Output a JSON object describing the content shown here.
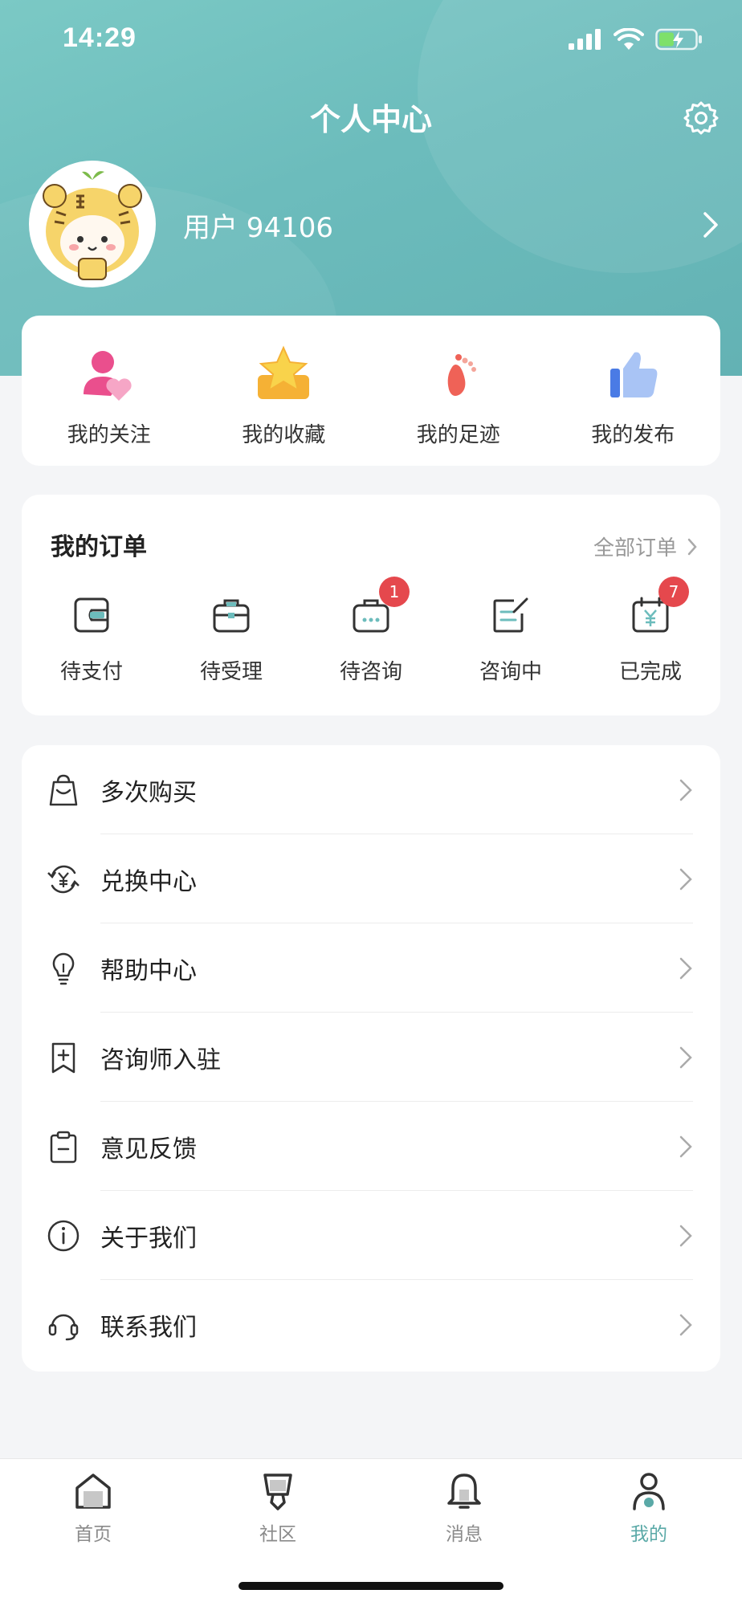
{
  "status": {
    "time": "14:29"
  },
  "header": {
    "title": "个人中心"
  },
  "profile": {
    "username": "用户 94106"
  },
  "quick_links": [
    {
      "label": "我的关注",
      "icon": "follow-icon"
    },
    {
      "label": "我的收藏",
      "icon": "star-icon"
    },
    {
      "label": "我的足迹",
      "icon": "footprint-icon"
    },
    {
      "label": "我的发布",
      "icon": "thumb-icon"
    }
  ],
  "orders": {
    "title": "我的订单",
    "all_label": "全部订单",
    "items": [
      {
        "label": "待支付",
        "badge": ""
      },
      {
        "label": "待受理",
        "badge": ""
      },
      {
        "label": "待咨询",
        "badge": "1"
      },
      {
        "label": "咨询中",
        "badge": ""
      },
      {
        "label": "已完成",
        "badge": "7"
      }
    ]
  },
  "menu": [
    {
      "label": "多次购买",
      "icon": "shopping-bag-icon"
    },
    {
      "label": "兑换中心",
      "icon": "exchange-icon"
    },
    {
      "label": "帮助中心",
      "icon": "lightbulb-icon"
    },
    {
      "label": "咨询师入驻",
      "icon": "bookmark-plus-icon"
    },
    {
      "label": "意见反馈",
      "icon": "clipboard-icon"
    },
    {
      "label": "关于我们",
      "icon": "info-icon"
    },
    {
      "label": "联系我们",
      "icon": "headset-icon"
    }
  ],
  "tabs": [
    {
      "label": "首页",
      "icon": "home-icon"
    },
    {
      "label": "社区",
      "icon": "community-icon"
    },
    {
      "label": "消息",
      "icon": "bell-icon"
    },
    {
      "label": "我的",
      "icon": "person-icon"
    }
  ],
  "colors": {
    "header": "#6cbcbc",
    "accent": "#5aa9a7",
    "badge": "#e5484d"
  }
}
